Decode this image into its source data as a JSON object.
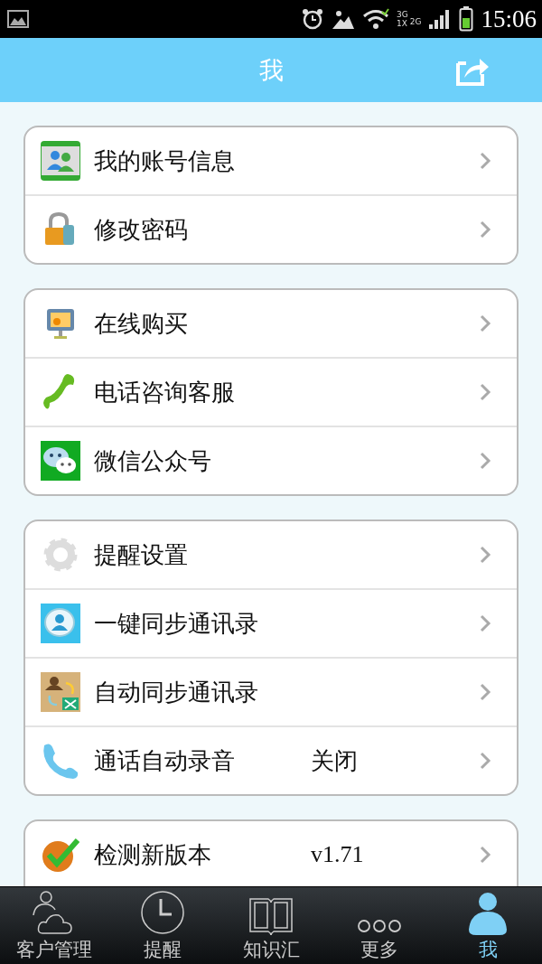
{
  "status_bar": {
    "network_labels": [
      "3G",
      "1X",
      "2G"
    ],
    "time": "15:06"
  },
  "header": {
    "title": "我"
  },
  "groups": [
    {
      "rows": [
        {
          "label": "我的账号信息"
        },
        {
          "label": "修改密码"
        }
      ]
    },
    {
      "rows": [
        {
          "label": "在线购买"
        },
        {
          "label": "电话咨询客服"
        },
        {
          "label": "微信公众号"
        }
      ]
    },
    {
      "rows": [
        {
          "label": "提醒设置"
        },
        {
          "label": "一键同步通讯录"
        },
        {
          "label": "自动同步通讯录"
        },
        {
          "label": "通话自动录音",
          "value": "关闭"
        }
      ]
    },
    {
      "rows": [
        {
          "label": "检测新版本",
          "value": "v1.71"
        }
      ]
    }
  ],
  "tabs": [
    {
      "label": "客户管理",
      "selected": false
    },
    {
      "label": "提醒",
      "selected": false
    },
    {
      "label": "知识汇",
      "selected": false
    },
    {
      "label": "更多",
      "selected": false
    },
    {
      "label": "我",
      "selected": true
    }
  ]
}
